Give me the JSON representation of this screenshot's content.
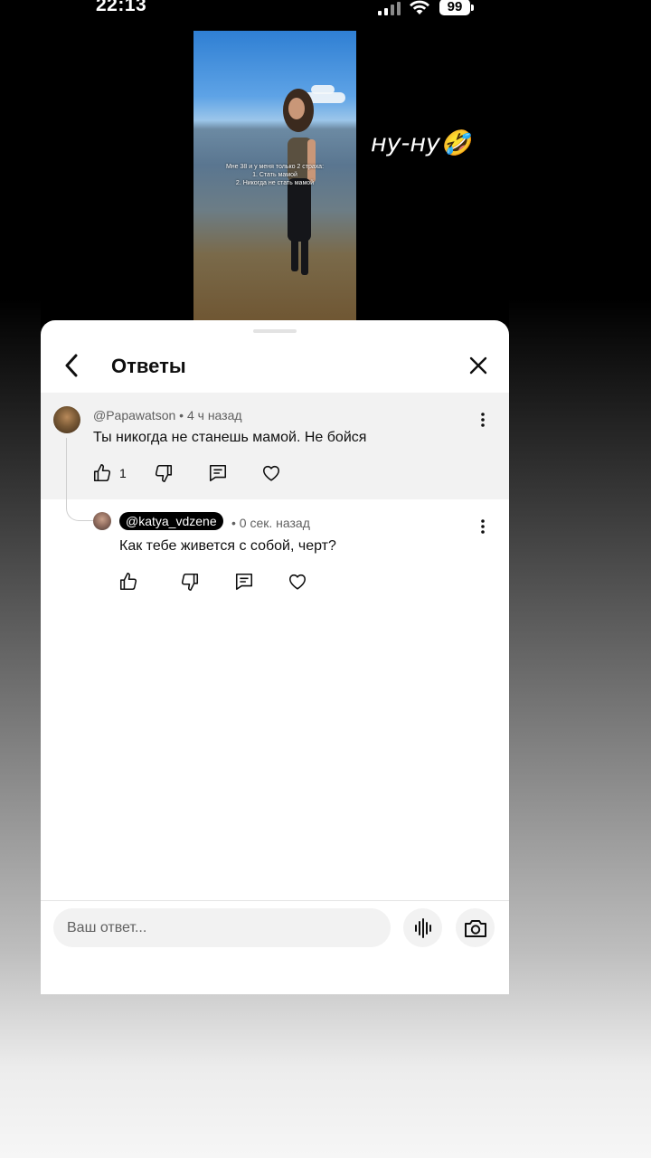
{
  "status_bar": {
    "time": "22:13",
    "battery": "99"
  },
  "video": {
    "caption_lines": [
      "Мне 38 и у меня только 2 страха:",
      "1. Стать мамой",
      "2. Никогда не стать мамой"
    ],
    "overlay_text": "ну-ну🤣"
  },
  "sheet": {
    "title": "Ответы"
  },
  "comments": [
    {
      "author": "@Papawatson",
      "time": "• 4 ч назад",
      "text": "Ты никогда не станешь мамой. Не бойся",
      "likes": "1"
    },
    {
      "author": "@katya_vdzene",
      "time": "• 0 сек. назад",
      "text": "Как тебе живется с собой, черт?"
    }
  ],
  "composer": {
    "placeholder": "Ваш ответ..."
  },
  "icons": {
    "back": "chevron-left-icon",
    "close": "close-icon",
    "more": "more-vertical-icon",
    "like": "thumbs-up-icon",
    "dislike": "thumbs-down-icon",
    "reply": "reply-icon",
    "heart": "heart-icon",
    "voice": "waveform-icon",
    "camera": "camera-icon"
  },
  "colors": {
    "sheet_bg": "#ffffff",
    "highlight_bg": "#f2f2f2",
    "pill_bg": "#000000",
    "meta": "#606060"
  }
}
